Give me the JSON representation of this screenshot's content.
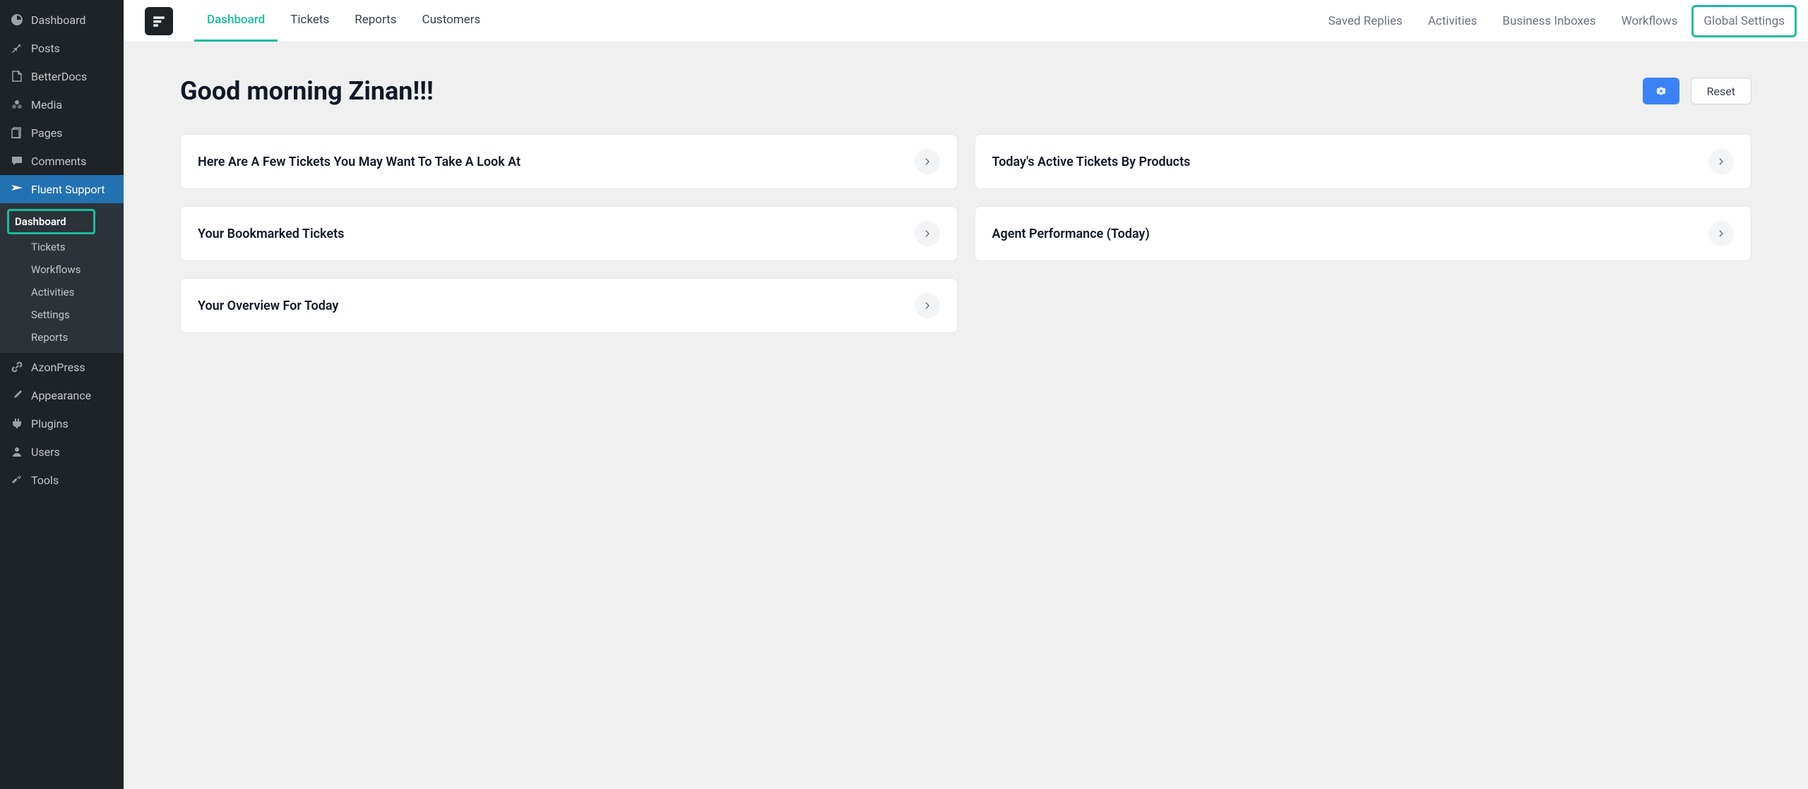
{
  "sidebar": {
    "items": [
      {
        "label": "Dashboard",
        "icon": "dashboard"
      },
      {
        "label": "Posts",
        "icon": "pin"
      },
      {
        "label": "BetterDocs",
        "icon": "docs"
      },
      {
        "label": "Media",
        "icon": "media"
      },
      {
        "label": "Pages",
        "icon": "pages"
      },
      {
        "label": "Comments",
        "icon": "comments"
      },
      {
        "label": "Fluent Support",
        "icon": "support"
      },
      {
        "label": "AzonPress",
        "icon": "link"
      },
      {
        "label": "Appearance",
        "icon": "brush"
      },
      {
        "label": "Plugins",
        "icon": "plugin"
      },
      {
        "label": "Users",
        "icon": "user"
      },
      {
        "label": "Tools",
        "icon": "wrench"
      }
    ],
    "submenu": {
      "items": [
        {
          "label": "Dashboard"
        },
        {
          "label": "Tickets"
        },
        {
          "label": "Workflows"
        },
        {
          "label": "Activities"
        },
        {
          "label": "Settings"
        },
        {
          "label": "Reports"
        }
      ]
    }
  },
  "topbar": {
    "tabs": [
      {
        "label": "Dashboard"
      },
      {
        "label": "Tickets"
      },
      {
        "label": "Reports"
      },
      {
        "label": "Customers"
      }
    ],
    "links": [
      {
        "label": "Saved Replies"
      },
      {
        "label": "Activities"
      },
      {
        "label": "Business Inboxes"
      },
      {
        "label": "Workflows"
      },
      {
        "label": "Global Settings"
      }
    ]
  },
  "main": {
    "greeting": "Good morning Zinan!!!",
    "reset_label": "Reset",
    "widgets": [
      {
        "title": "Here Are A Few Tickets You May Want To Take A Look At"
      },
      {
        "title": "Today's Active Tickets By Products"
      },
      {
        "title": "Your Bookmarked Tickets"
      },
      {
        "title": "Agent Performance (Today)"
      },
      {
        "title": "Your Overview For Today"
      }
    ]
  },
  "colors": {
    "accent": "#1abc9c",
    "primary_blue": "#3b82f6",
    "sidebar_bg": "#1d2327"
  }
}
